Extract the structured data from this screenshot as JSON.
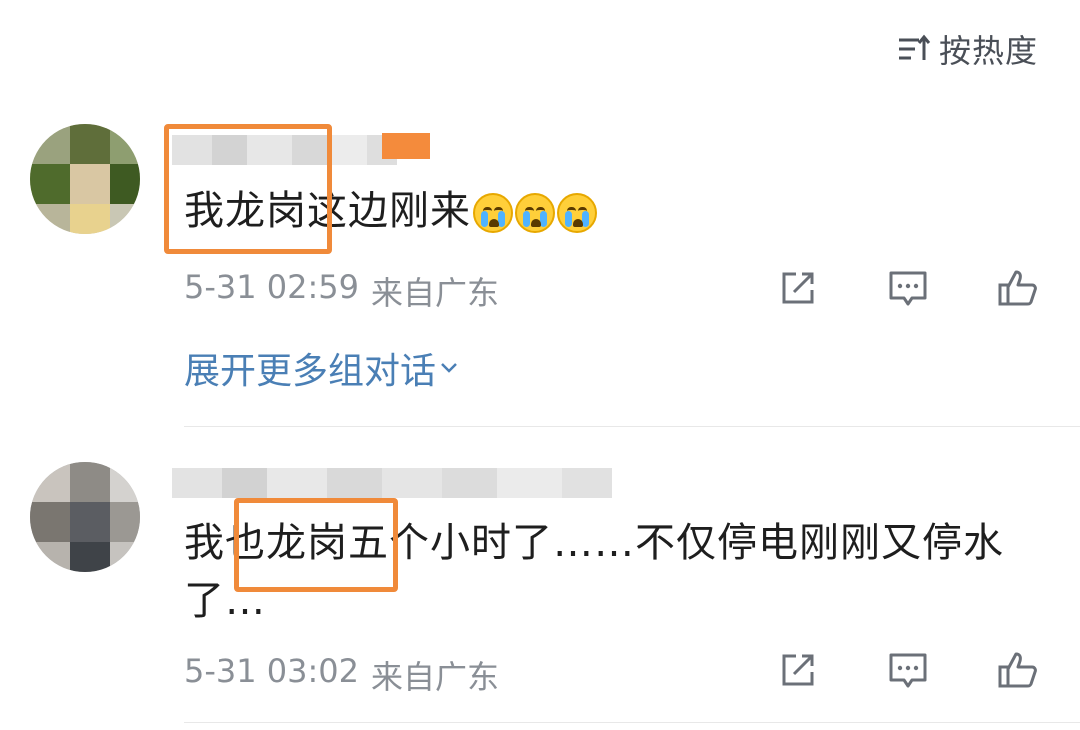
{
  "sort": {
    "label": "按热度",
    "icon": "sort-lines-icon"
  },
  "comments": [
    {
      "text": "我龙岗这边刚来",
      "emojis": [
        "crying-face-icon",
        "crying-face-icon",
        "crying-face-icon"
      ],
      "time": "5-31 02:59",
      "location": "来自广东",
      "expand_label": "展开更多组对话",
      "actions": [
        "share-icon",
        "comment-icon",
        "like-icon"
      ]
    },
    {
      "text": "我也龙岗五个小时了……不仅停电刚刚又停水了…",
      "time": "5-31 03:02",
      "location": "来自广东",
      "actions": [
        "share-icon",
        "comment-icon",
        "like-icon"
      ]
    }
  ],
  "colors": {
    "highlight": "#f08a3a",
    "link": "#4a7fb5",
    "meta": "#8a8f96",
    "badge": "#f48b3c"
  }
}
